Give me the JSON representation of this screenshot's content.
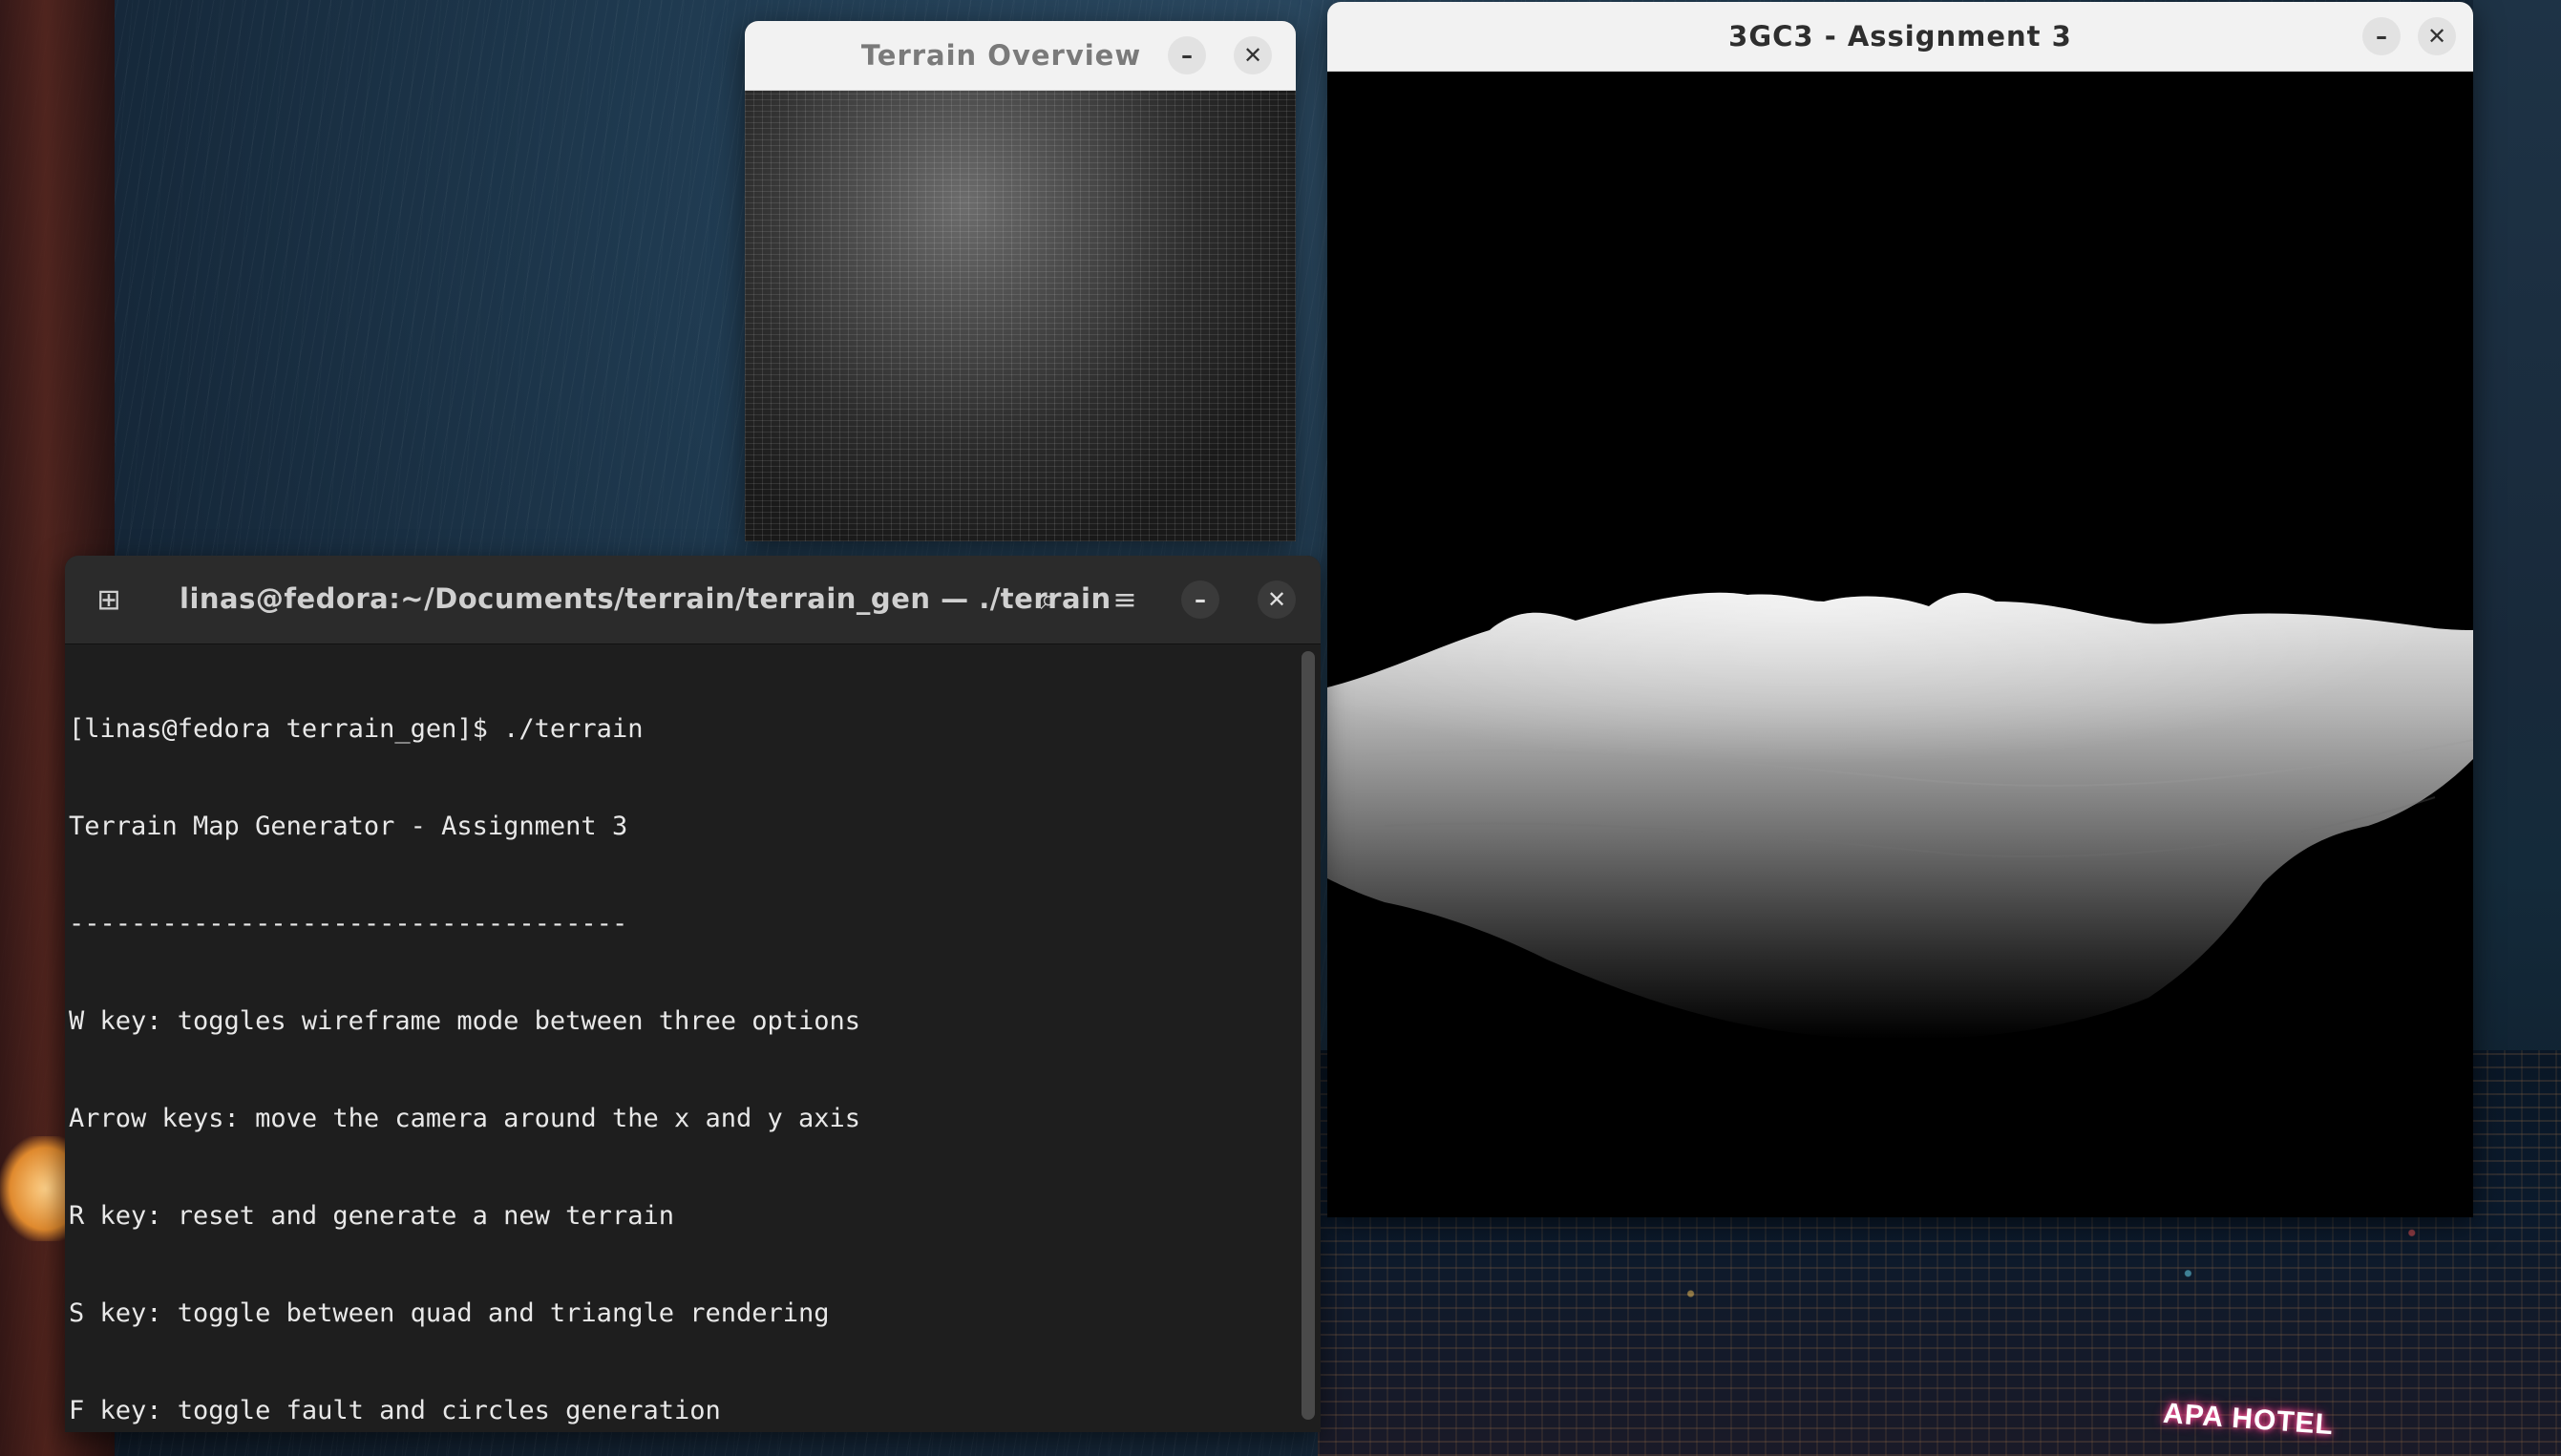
{
  "desktop": {
    "hotel_sign": "APA HOTEL"
  },
  "overview_window": {
    "title": "Terrain Overview",
    "minimize_glyph": "–",
    "close_glyph": "✕"
  },
  "main_window": {
    "title": "3GC3 - Assignment 3",
    "minimize_glyph": "–",
    "close_glyph": "✕"
  },
  "terminal": {
    "title": "linas@fedora:~/Documents/terrain/terrain_gen — ./terrain",
    "new_tab_glyph": "⊞",
    "search_glyph": "⌕",
    "menu_glyph": "≡",
    "minimize_glyph": "–",
    "close_glyph": "✕",
    "lines": [
      "[linas@fedora terrain_gen]$ ./terrain",
      "Terrain Map Generator - Assignment 3",
      "------------------------------------",
      "W key: toggles wireframe mode between three options",
      "Arrow keys: move the camera around the x and y axis",
      "R key: reset and generate a new terrain",
      "S key: toggle between quad and triangle rendering",
      "F key: toggle fault and circles generation"
    ]
  },
  "colors": {
    "terminal_bg": "#1e1e1e",
    "titlebar_light": "#f2f2f2",
    "titlebar_dark": "#2b2b2b"
  }
}
